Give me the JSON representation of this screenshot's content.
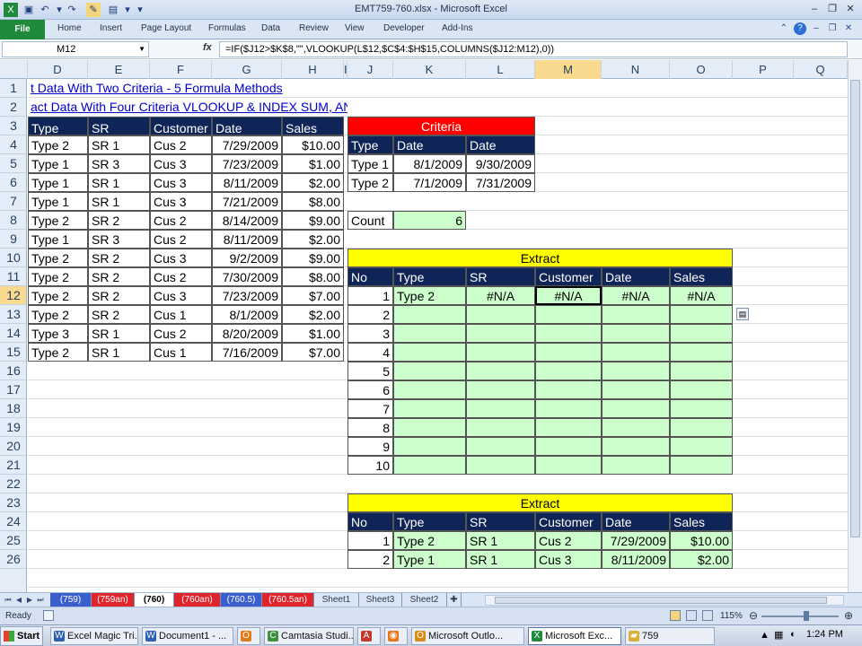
{
  "window": {
    "title": "EMT759-760.xlsx - Microsoft Excel"
  },
  "ribbon": {
    "file": "File",
    "tabs": [
      "Home",
      "Insert",
      "Page Layout",
      "Formulas",
      "Data",
      "Review",
      "View",
      "Developer",
      "Add-Ins"
    ]
  },
  "formula_bar": {
    "name_box": "M12",
    "fx": "fx",
    "formula": "=IF($J12>$K$8,\"\",VLOOKUP(L$12,$C$4:$H$15,COLUMNS($J12:M12),0))"
  },
  "columns": [
    "D",
    "E",
    "F",
    "G",
    "H",
    "I",
    "J",
    "K",
    "L",
    "M",
    "N",
    "O",
    "P",
    "Q"
  ],
  "active_column": "M",
  "rows": [
    "1",
    "2",
    "3",
    "4",
    "5",
    "6",
    "7",
    "8",
    "9",
    "10",
    "11",
    "12",
    "13",
    "14",
    "15",
    "16",
    "17",
    "18",
    "19",
    "20",
    "21",
    "22",
    "23",
    "24",
    "25",
    "26"
  ],
  "active_row": "12",
  "links": {
    "row1": "t Data With Two Criteria - 5 Formula Methods",
    "row2": "act Data With Four Criteria VLOOKUP & INDEX SUM, AND, OR Functions"
  },
  "main_table": {
    "headers": [
      "Type",
      "SR",
      "Customer",
      "Date",
      "Sales"
    ],
    "rows": [
      [
        "Type 2",
        "SR 1",
        "Cus 2",
        "7/29/2009",
        "$10.00"
      ],
      [
        "Type 1",
        "SR 3",
        "Cus 3",
        "7/23/2009",
        "$1.00"
      ],
      [
        "Type 1",
        "SR 1",
        "Cus 3",
        "8/11/2009",
        "$2.00"
      ],
      [
        "Type 1",
        "SR 1",
        "Cus 3",
        "7/21/2009",
        "$8.00"
      ],
      [
        "Type 2",
        "SR 2",
        "Cus 2",
        "8/14/2009",
        "$9.00"
      ],
      [
        "Type 1",
        "SR 3",
        "Cus 2",
        "8/11/2009",
        "$2.00"
      ],
      [
        "Type 2",
        "SR 2",
        "Cus 3",
        "9/2/2009",
        "$9.00"
      ],
      [
        "Type 2",
        "SR 2",
        "Cus 2",
        "7/30/2009",
        "$8.00"
      ],
      [
        "Type 2",
        "SR 2",
        "Cus 3",
        "7/23/2009",
        "$7.00"
      ],
      [
        "Type 2",
        "SR 2",
        "Cus 1",
        "8/1/2009",
        "$2.00"
      ],
      [
        "Type 3",
        "SR 1",
        "Cus 2",
        "8/20/2009",
        "$1.00"
      ],
      [
        "Type 2",
        "SR 1",
        "Cus 1",
        "7/16/2009",
        "$7.00"
      ]
    ]
  },
  "criteria": {
    "title": "Criteria",
    "headers": [
      "Type",
      "Date",
      "Date"
    ],
    "rows": [
      [
        "Type 1",
        "8/1/2009",
        "9/30/2009"
      ],
      [
        "Type 2",
        "7/1/2009",
        "7/31/2009"
      ]
    ],
    "count_label": "Count",
    "count_value": "6"
  },
  "extract1": {
    "title": "Extract",
    "headers": [
      "No",
      "Type",
      "SR",
      "Customer",
      "Date",
      "Sales"
    ],
    "rows": [
      [
        "1",
        "Type 2",
        "#N/A",
        "#N/A",
        "#N/A",
        "#N/A"
      ],
      [
        "2",
        "",
        "",
        "",
        "",
        ""
      ],
      [
        "3",
        "",
        "",
        "",
        "",
        ""
      ],
      [
        "4",
        "",
        "",
        "",
        "",
        ""
      ],
      [
        "5",
        "",
        "",
        "",
        "",
        ""
      ],
      [
        "6",
        "",
        "",
        "",
        "",
        ""
      ],
      [
        "7",
        "",
        "",
        "",
        "",
        ""
      ],
      [
        "8",
        "",
        "",
        "",
        "",
        ""
      ],
      [
        "9",
        "",
        "",
        "",
        "",
        ""
      ],
      [
        "10",
        "",
        "",
        "",
        "",
        ""
      ]
    ]
  },
  "extract2": {
    "title": "Extract",
    "headers": [
      "No",
      "Type",
      "SR",
      "Customer",
      "Date",
      "Sales"
    ],
    "rows": [
      [
        "1",
        "Type 2",
        "SR 1",
        "Cus 2",
        "7/29/2009",
        "$10.00"
      ],
      [
        "2",
        "Type 1",
        "SR 1",
        "Cus 3",
        "8/11/2009",
        "$2.00"
      ]
    ]
  },
  "sheet_tabs": [
    {
      "label": "(759)",
      "style": "blue"
    },
    {
      "label": "(759an)",
      "style": "red"
    },
    {
      "label": "(760)",
      "style": "active"
    },
    {
      "label": "(760an)",
      "style": "red"
    },
    {
      "label": "(760.5)",
      "style": "blue"
    },
    {
      "label": "(760.5an)",
      "style": "red"
    },
    {
      "label": "Sheet1",
      "style": "plain"
    },
    {
      "label": "Sheet3",
      "style": "plain"
    },
    {
      "label": "Sheet2",
      "style": "plain"
    }
  ],
  "status": {
    "ready": "Ready",
    "zoom": "115%"
  },
  "taskbar": {
    "start": "Start",
    "items": [
      "Excel Magic Tri...",
      "Document1 - ...",
      "",
      "Camtasia Studi...",
      "",
      "",
      "Microsoft Outlo...",
      "Microsoft Exc...",
      "759"
    ],
    "clock": "1:24 PM"
  },
  "colors": {
    "navy": "#0f2557",
    "criteria_red": "#ff0000",
    "extract_yellow": "#ffff00",
    "extract_green": "#ccffcc",
    "file_tab": "#1f8a3c"
  }
}
